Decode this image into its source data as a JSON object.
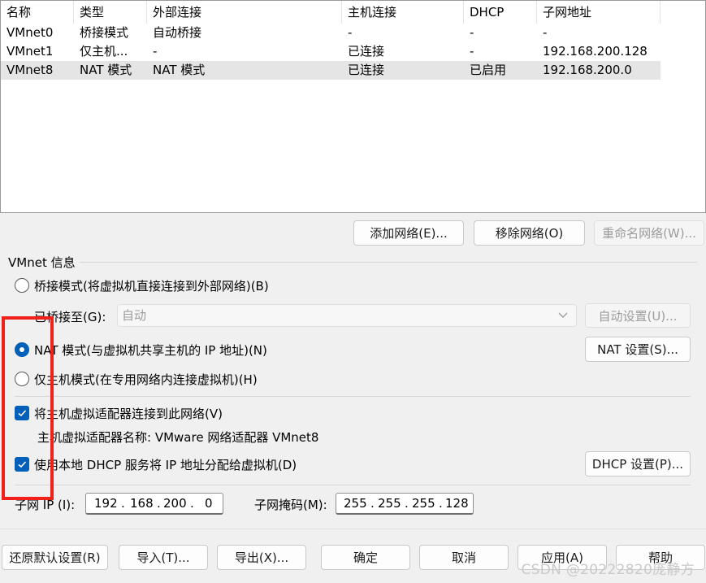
{
  "network_table": {
    "columns": [
      "名称",
      "类型",
      "外部连接",
      "主机连接",
      "DHCP",
      "子网地址"
    ],
    "rows": [
      {
        "name": "VMnet0",
        "type": "桥接模式",
        "external": "自动桥接",
        "host": "-",
        "dhcp": "-",
        "subnet": "-"
      },
      {
        "name": "VMnet1",
        "type": "仅主机...",
        "external": "-",
        "host": "已连接",
        "dhcp": "-",
        "subnet": "192.168.200.128"
      },
      {
        "name": "VMnet8",
        "type": "NAT 模式",
        "external": "NAT 模式",
        "host": "已连接",
        "dhcp": "已启用",
        "subnet": "192.168.200.0"
      }
    ],
    "selected_row": 2
  },
  "table_buttons": {
    "add": "添加网络(E)...",
    "remove": "移除网络(O)",
    "rename": "重命名网络(W)..."
  },
  "vmnet_info": {
    "group_title": "VMnet 信息",
    "bridged_label": "桥接模式(将虚拟机直接连接到外部网络)(B)",
    "bridged_to_label": "已桥接至(G):",
    "bridged_to_value": "自动",
    "auto_settings": "自动设置(U)...",
    "nat_label": "NAT 模式(与虚拟机共享主机的 IP 地址)(N)",
    "nat_settings": "NAT 设置(S)...",
    "hostonly_label": "仅主机模式(在专用网络内连接虚拟机)(H)",
    "selected_mode": "nat",
    "connect_adapter_label": "将主机虚拟适配器连接到此网络(V)",
    "connect_adapter_checked": true,
    "adapter_name_label": "主机虚拟适配器名称: VMware 网络适配器 VMnet8",
    "use_dhcp_label": "使用本地 DHCP 服务将 IP 地址分配给虚拟机(D)",
    "use_dhcp_checked": true,
    "dhcp_settings": "DHCP 设置(P)...",
    "subnet_ip_label": "子网 IP (I):",
    "subnet_ip": [
      "192",
      "168",
      "200",
      "0"
    ],
    "subnet_mask_label": "子网掩码(M):",
    "subnet_mask": [
      "255",
      "255",
      "255",
      "128"
    ]
  },
  "footer_buttons": {
    "restore_defaults": "还原默认设置(R)",
    "import": "导入(T)...",
    "export": "导出(X)...",
    "ok": "确定",
    "cancel": "取消",
    "apply": "应用(A)",
    "help": "帮助"
  },
  "watermark": "CSDN @20222820庞静方",
  "colors": {
    "accent": "#005fb8",
    "highlight_rect": "#f2201b",
    "selected_row": "#e5e5e5"
  }
}
